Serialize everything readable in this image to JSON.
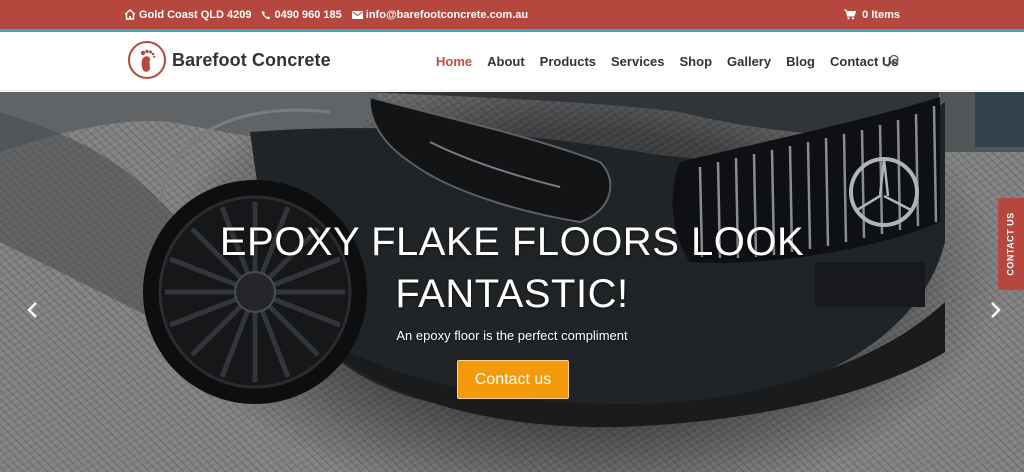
{
  "topbar": {
    "location": "Gold Coast QLD 4209",
    "phone": "0490 960 185",
    "email": "info@barefootconcrete.com.au",
    "cart": "0 Items",
    "background": "#b5473e",
    "accent": "#3fa7b8"
  },
  "header": {
    "logo_text": "Barefoot Concrete",
    "nav": {
      "home": "Home",
      "about": "About",
      "products": "Products",
      "services": "Services",
      "shop": "Shop",
      "gallery": "Gallery",
      "blog": "Blog",
      "contact": "Contact Us"
    },
    "active_item": "Home",
    "active_color": "#c24f41"
  },
  "hero": {
    "title_line1": "EPOXY FLAKE FLOORS LOOK",
    "title_line2": "FANTASTIC!",
    "subtitle": "An epoxy floor is the perfect compliment",
    "cta_label": "Contact us",
    "cta_color": "#f29a0b"
  },
  "side_tab": {
    "label": "CONTACT US"
  },
  "icons": {
    "location": "home-icon",
    "phone": "phone-icon",
    "email": "envelope-icon",
    "cart": "cart-icon",
    "search": "search-icon",
    "prev": "chevron-left-icon",
    "next": "chevron-right-icon",
    "logo": "footprint-icon"
  }
}
